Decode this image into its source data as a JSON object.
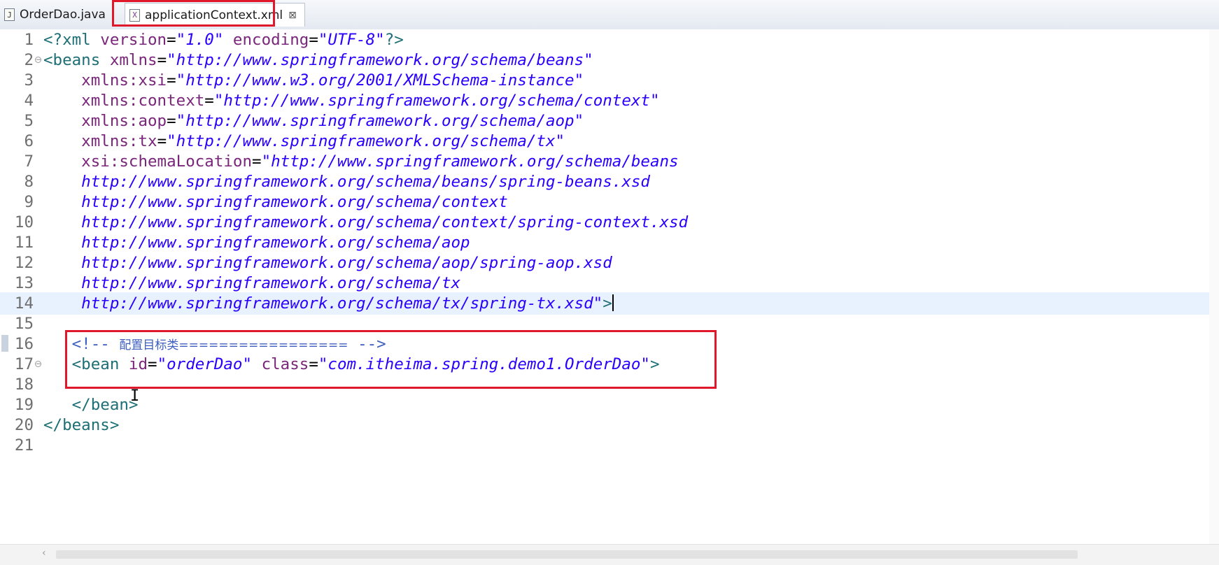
{
  "tabs": [
    {
      "label": "OrderDao.java",
      "icon": "java-file-icon",
      "icon_glyph": "J"
    },
    {
      "label": "applicationContext.xml",
      "icon": "xml-file-icon",
      "icon_glyph": "X",
      "active": true,
      "close_glyph": "⊠"
    }
  ],
  "editor": {
    "language": "xml",
    "current_line": 14,
    "highlight_color": "#e0182c",
    "lines": [
      {
        "n": "1",
        "segments": [
          {
            "t": "tg",
            "v": "<?xml "
          },
          {
            "t": "at",
            "v": "version"
          },
          {
            "t": "eq",
            "v": "="
          },
          {
            "t": "st",
            "v": "\"1.0\""
          },
          {
            "t": "at",
            "v": " encoding"
          },
          {
            "t": "eq",
            "v": "="
          },
          {
            "t": "st",
            "v": "\"UTF-8\""
          },
          {
            "t": "tg",
            "v": "?>"
          }
        ]
      },
      {
        "n": "2",
        "fold": true,
        "segments": [
          {
            "t": "tg",
            "v": "<beans "
          },
          {
            "t": "at",
            "v": "xmlns"
          },
          {
            "t": "eq",
            "v": "="
          },
          {
            "t": "st",
            "v": "\"http://www.springframework.org/schema/beans\""
          }
        ]
      },
      {
        "n": "3",
        "segments": [
          {
            "t": "at",
            "v": "    xmlns:xsi"
          },
          {
            "t": "eq",
            "v": "="
          },
          {
            "t": "st",
            "v": "\"http://www.w3.org/2001/XMLSchema-instance\""
          }
        ]
      },
      {
        "n": "4",
        "segments": [
          {
            "t": "at",
            "v": "    xmlns:context"
          },
          {
            "t": "eq",
            "v": "="
          },
          {
            "t": "st",
            "v": "\"http://www.springframework.org/schema/context\""
          }
        ]
      },
      {
        "n": "5",
        "segments": [
          {
            "t": "at",
            "v": "    xmlns:aop"
          },
          {
            "t": "eq",
            "v": "="
          },
          {
            "t": "st",
            "v": "\"http://www.springframework.org/schema/aop\""
          }
        ]
      },
      {
        "n": "6",
        "segments": [
          {
            "t": "at",
            "v": "    xmlns:tx"
          },
          {
            "t": "eq",
            "v": "="
          },
          {
            "t": "st",
            "v": "\"http://www.springframework.org/schema/tx\""
          }
        ]
      },
      {
        "n": "7",
        "segments": [
          {
            "t": "at",
            "v": "    xsi:schemaLocation"
          },
          {
            "t": "eq",
            "v": "="
          },
          {
            "t": "st",
            "v": "\"http://www.springframework.org/schema/beans"
          }
        ]
      },
      {
        "n": "8",
        "segments": [
          {
            "t": "st",
            "v": "    http://www.springframework.org/schema/beans/spring-beans.xsd"
          }
        ]
      },
      {
        "n": "9",
        "segments": [
          {
            "t": "st",
            "v": "    http://www.springframework.org/schema/context"
          }
        ]
      },
      {
        "n": "10",
        "segments": [
          {
            "t": "st",
            "v": "    http://www.springframework.org/schema/context/spring-context.xsd"
          }
        ]
      },
      {
        "n": "11",
        "segments": [
          {
            "t": "st",
            "v": "    http://www.springframework.org/schema/aop"
          }
        ]
      },
      {
        "n": "12",
        "segments": [
          {
            "t": "st",
            "v": "    http://www.springframework.org/schema/aop/spring-aop.xsd"
          }
        ]
      },
      {
        "n": "13",
        "segments": [
          {
            "t": "st",
            "v": "    http://www.springframework.org/schema/tx"
          }
        ]
      },
      {
        "n": "14",
        "caret": true,
        "segments": [
          {
            "t": "st",
            "v": "    http://www.springframework.org/schema/tx/spring-tx.xsd\""
          },
          {
            "t": "tg",
            "v": ">"
          }
        ]
      },
      {
        "n": "15",
        "segments": []
      },
      {
        "n": "16",
        "segments": [
          {
            "t": "cm",
            "v": "   <!-- "
          },
          {
            "t": "cm cm-cn",
            "v": "配置目标类================="
          },
          {
            "t": "cm",
            "v": " -->"
          }
        ]
      },
      {
        "n": "17",
        "fold": true,
        "segments": [
          {
            "t": "tg",
            "v": "   <bean "
          },
          {
            "t": "at",
            "v": "id"
          },
          {
            "t": "eq",
            "v": "="
          },
          {
            "t": "st",
            "v": "\"orderDao\""
          },
          {
            "t": "at",
            "v": " class"
          },
          {
            "t": "eq",
            "v": "="
          },
          {
            "t": "st",
            "v": "\"com.itheima.spring.demo1.OrderDao\""
          },
          {
            "t": "tg",
            "v": ">"
          }
        ]
      },
      {
        "n": "18",
        "segments": []
      },
      {
        "n": "19",
        "segments": [
          {
            "t": "tg",
            "v": "   </bean>"
          }
        ]
      },
      {
        "n": "20",
        "segments": [
          {
            "t": "tg",
            "v": "</beans>"
          }
        ]
      },
      {
        "n": "21",
        "segments": []
      }
    ]
  }
}
